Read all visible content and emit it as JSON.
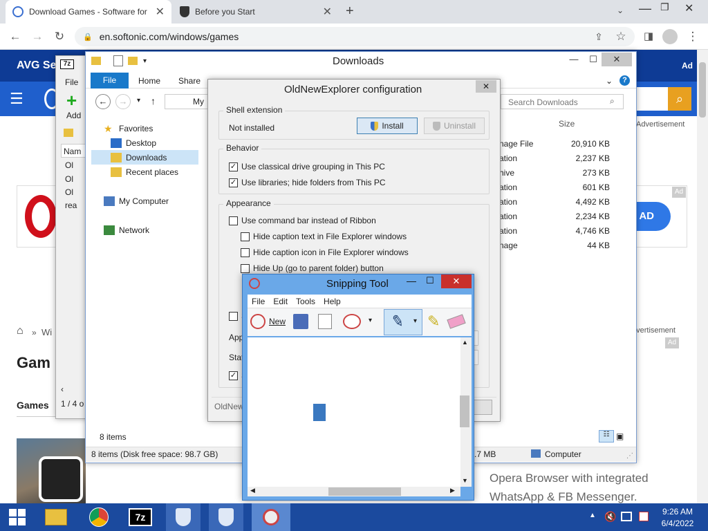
{
  "browser": {
    "tabs": [
      {
        "title": "Download Games - Software for",
        "active": true
      },
      {
        "title": "Before you Start",
        "active": false
      }
    ],
    "url": "en.softonic.com/windows/games"
  },
  "webpage": {
    "brand_text": "AVG Se",
    "ad_label": "Ad",
    "search_placeholder": "",
    "advertisement_1": "Advertisement",
    "advertisement_2": "dvertisement",
    "ad_badge_1": "Ad",
    "ad_badge_2": "Ad",
    "breadcrumb_home": "⌂",
    "breadcrumb_sep": "»",
    "breadcrumb_win": "Wi",
    "heading": "Gam",
    "subheading": "Games",
    "download_btn": "AD",
    "opera_text_1": "Opera Browser with integrated",
    "opera_text_2": "WhatsApp & FB Messenger."
  },
  "sevenzip": {
    "title_icon": "7z",
    "menu_file": "File",
    "add_label": "Add",
    "col_name": "Nam",
    "rows": [
      "Ol",
      "Ol",
      "Ol",
      "rea"
    ],
    "status": "1 / 4 o"
  },
  "explorer": {
    "title": "Downloads",
    "ribbon_tabs": [
      "File",
      "Home",
      "Share"
    ],
    "path_text": "My",
    "search_placeholder": "Search Downloads",
    "col_size": "Size",
    "nav": {
      "favorites": "Favorites",
      "desktop": "Desktop",
      "downloads": "Downloads",
      "recent": "Recent places",
      "computer": "My Computer",
      "network": "Network"
    },
    "files": [
      {
        "type": "nage File",
        "size": "20,910 KB"
      },
      {
        "type": "ation",
        "size": "2,237 KB"
      },
      {
        "type": "hive",
        "size": "273 KB"
      },
      {
        "type": "ation",
        "size": "601 KB"
      },
      {
        "type": "ation",
        "size": "4,492 KB"
      },
      {
        "type": "ation",
        "size": "2,234 KB"
      },
      {
        "type": "ation",
        "size": "4,746 KB"
      },
      {
        "type": "nage",
        "size": "44 KB"
      }
    ],
    "item_count": "8 items",
    "status_left": "8 items (Disk free space: 98.7 GB)",
    "status_size": ".7 MB",
    "status_computer": "Computer"
  },
  "oldnew": {
    "title": "OldNewExplorer configuration",
    "shell_group": "Shell extension",
    "shell_status": "Not installed",
    "install_btn": "Install",
    "uninstall_btn": "Uninstall",
    "behavior_group": "Behavior",
    "behavior_opts": [
      {
        "label": "Use classical drive grouping in This PC",
        "checked": true
      },
      {
        "label": "Use libraries; hide folders from This PC",
        "checked": true
      }
    ],
    "appearance_group": "Appearance",
    "appearance_opts": [
      {
        "label": "Use command bar instead of Ribbon",
        "checked": false
      },
      {
        "label": "Hide caption text in File Explorer windows",
        "checked": false
      },
      {
        "label": "Hide caption icon in File Explorer windows",
        "checked": false
      },
      {
        "label": "Hide Up (go to parent folder) button",
        "checked": false
      }
    ],
    "partial_s": "S",
    "partial_app": "App",
    "partial_stat": "Stat",
    "partial_s2": "S",
    "footer": "OldNew"
  },
  "snipping": {
    "title": "Snipping Tool",
    "menu": [
      "File",
      "Edit",
      "Tools",
      "Help"
    ],
    "new_label": "New"
  },
  "taskbar": {
    "time": "9:26 AM",
    "date": "6/4/2022",
    "sevenzip_label": "7z"
  },
  "colors": {
    "avg_blue": "#0e3b95",
    "nav_blue": "#1f5fcc",
    "taskbar": "#1b4a9e",
    "explorer_file_tab": "#1979ca",
    "snip_title": "#6aa8e8",
    "accent_orange": "#e8a020"
  }
}
